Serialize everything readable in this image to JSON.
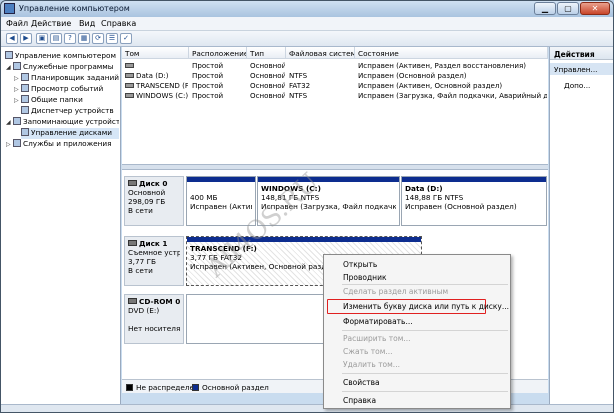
{
  "window": {
    "title": "Управление компьютером"
  },
  "menu": [
    "Файл",
    "Действие",
    "Вид",
    "Справка"
  ],
  "toolbar": {
    "buttons": [
      {
        "name": "back-icon",
        "glyph": "◀"
      },
      {
        "name": "forward-icon",
        "glyph": "▶"
      },
      {
        "name": "up-folder-icon",
        "glyph": "▣"
      },
      {
        "name": "show-hide-tree-icon",
        "glyph": "▤"
      },
      {
        "name": "help-icon",
        "glyph": "?"
      },
      {
        "name": "properties-icon",
        "glyph": "▦"
      },
      {
        "name": "refresh-icon",
        "glyph": "⟳"
      },
      {
        "name": "list-icon",
        "glyph": "☰"
      },
      {
        "name": "checklist-icon",
        "glyph": "✓"
      }
    ]
  },
  "tree": [
    {
      "label": "Управление компьютером (л",
      "indent": 0,
      "expander": ""
    },
    {
      "label": "Служебные программы",
      "indent": 1,
      "expander": "◢"
    },
    {
      "label": "Планировщик заданий",
      "indent": 2,
      "expander": "▷"
    },
    {
      "label": "Просмотр событий",
      "indent": 2,
      "expander": "▷"
    },
    {
      "label": "Общие папки",
      "indent": 2,
      "expander": "▷"
    },
    {
      "label": "Диспетчер устройств",
      "indent": 2,
      "expander": ""
    },
    {
      "label": "Запоминающие устройст",
      "indent": 1,
      "expander": "◢"
    },
    {
      "label": "Управление дисками",
      "indent": 2,
      "expander": "",
      "selected": true
    },
    {
      "label": "Службы и приложения",
      "indent": 1,
      "expander": "▷"
    }
  ],
  "volumes": {
    "columns": [
      "Том",
      "Расположение",
      "Тип",
      "Файловая система",
      "Состояние"
    ],
    "rows": [
      [
        "",
        "Простой",
        "Основной",
        "",
        "Исправен (Активен, Раздел восстановления)"
      ],
      [
        "Data (D:)",
        "Простой",
        "Основной",
        "NTFS",
        "Исправен (Основной раздел)"
      ],
      [
        "TRANSCEND (F:)",
        "Простой",
        "Основной",
        "FAT32",
        "Исправен (Активен, Основной раздел)"
      ],
      [
        "WINDOWS (C:)",
        "Простой",
        "Основной",
        "NTFS",
        "Исправен (Загрузка, Файл подкачки, Аварийный дамп па"
      ]
    ]
  },
  "disks": [
    {
      "lines": [
        "Диск 0",
        "Основной",
        "298,09 ГБ",
        "В сети"
      ],
      "partitions": [
        {
          "lines": [
            "",
            "400 МБ",
            "Исправен (Активен"
          ]
        },
        {
          "lines": [
            "WINDOWS (C:)",
            "148,81 ГБ NTFS",
            "Исправен (Загрузка, Файл подкачки, Ава"
          ]
        },
        {
          "lines": [
            "Data (D:)",
            "148,88 ГБ NTFS",
            "Исправен (Основной раздел)"
          ]
        }
      ]
    },
    {
      "lines": [
        "Диск 1",
        "Съемное устро",
        "3,77 ГБ",
        "В сети"
      ],
      "partitions": [
        {
          "lines": [
            "TRANSCEND (F:)",
            "3,77 ГБ FAT32",
            "Исправен (Активен, Основной раздел)"
          ]
        }
      ]
    },
    {
      "lines": [
        "CD-ROM 0",
        "DVD (E:)",
        "",
        "Нет носителя"
      ],
      "partitions": []
    }
  ],
  "legend": [
    "Не распределен",
    "Основной раздел"
  ],
  "legend_colors": [
    "#000000",
    "#0d2d8f"
  ],
  "actions": {
    "header": "Действия",
    "selected": "Управлен...",
    "more": "Допо..."
  },
  "context_menu": [
    {
      "label": "Открыть",
      "disabled": false
    },
    {
      "label": "Проводник",
      "disabled": false
    },
    {
      "label": "Сделать раздел активным",
      "disabled": true
    },
    {
      "label": "Изменить букву диска или путь к диску...",
      "disabled": false,
      "highlighted": true
    },
    {
      "label": "Форматировать...",
      "disabled": false
    },
    {
      "label": "Расширить том...",
      "disabled": true
    },
    {
      "label": "Сжать том...",
      "disabled": true
    },
    {
      "label": "Удалить том...",
      "disabled": true
    },
    {
      "label": "Свойства",
      "disabled": false
    },
    {
      "label": "Справка",
      "disabled": false
    }
  ],
  "watermark": "All4OS.RU"
}
